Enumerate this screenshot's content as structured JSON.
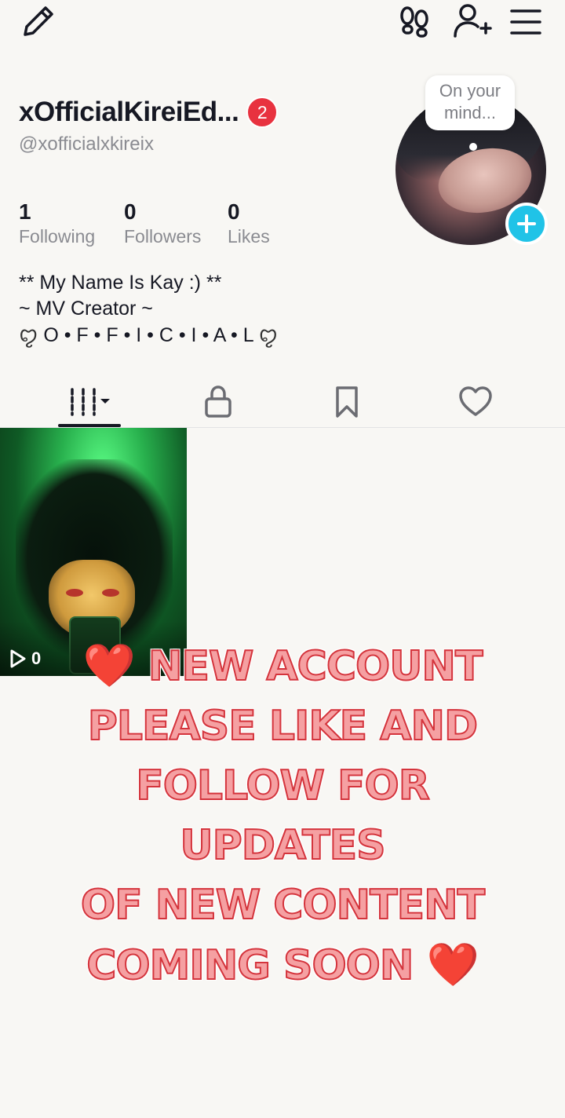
{
  "header": {
    "edit_icon": "pencil-icon",
    "footprint_icon": "footprints-icon",
    "add_friend_icon": "add-user-icon",
    "menu_icon": "hamburger-menu-icon"
  },
  "profile": {
    "display_name": "xOfficialKireiEd...",
    "badge_count": "2",
    "username": "@xofficialxkireix",
    "note": {
      "line1": "On your",
      "line2": "mind..."
    },
    "stats": [
      {
        "value": "1",
        "label": "Following"
      },
      {
        "value": "0",
        "label": "Followers"
      },
      {
        "value": "0",
        "label": "Likes"
      }
    ],
    "bio": {
      "line1": "** My Name Is Kay :) **",
      "line2": "~ MV Creator ~",
      "line3": "O • F • F • I • C • I • A • L"
    }
  },
  "tabs": [
    {
      "name": "videos",
      "icon": "grid-icon",
      "active": true
    },
    {
      "name": "private",
      "icon": "lock-icon",
      "active": false
    },
    {
      "name": "saved",
      "icon": "bookmark-icon",
      "active": false
    },
    {
      "name": "liked",
      "icon": "heart-icon",
      "active": false
    }
  ],
  "videos": [
    {
      "views": "0"
    }
  ],
  "overlay": {
    "heart": "❤️",
    "line1": "NEW ACCOUNT",
    "line2": "PLEASE LIKE AND",
    "line3": "FOLLOW FOR UPDATES",
    "line4": "OF NEW CONTENT",
    "line5": "COMING SOON"
  },
  "colors": {
    "background": "#f8f7f4",
    "badge": "#e8323f",
    "add_story": "#20c3e7",
    "promo_text": "#f5a0a2",
    "promo_outline": "#d4343c"
  }
}
